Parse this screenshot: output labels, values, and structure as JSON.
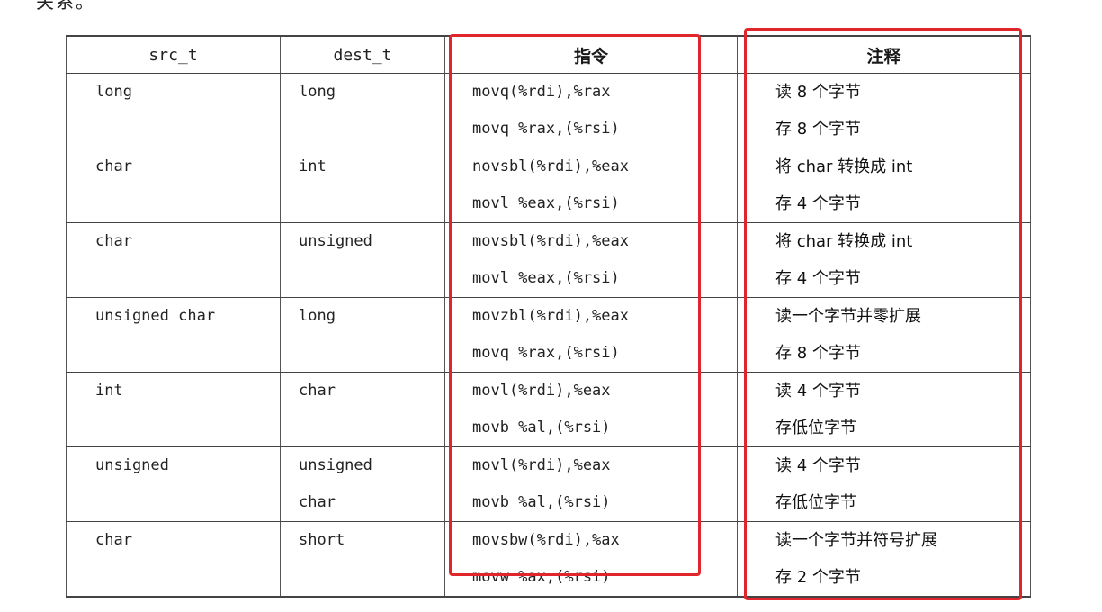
{
  "intro": "关系。",
  "table": {
    "headers": [
      "src_t",
      "dest_t",
      "指令",
      "注释"
    ],
    "rows": [
      {
        "src": [
          "long"
        ],
        "dest": [
          "long"
        ],
        "instr": [
          "movq(%rdi),%rax",
          "movq %rax,(%rsi)"
        ],
        "comment": [
          "读 8 个字节",
          "存 8 个字节"
        ]
      },
      {
        "src": [
          "char"
        ],
        "dest": [
          "int"
        ],
        "instr": [
          "novsbl(%rdi),%eax",
          "movl %eax,(%rsi)"
        ],
        "comment": [
          "将 char 转换成 int",
          "存 4 个字节"
        ]
      },
      {
        "src": [
          "char"
        ],
        "dest": [
          "unsigned"
        ],
        "instr": [
          "movsbl(%rdi),%eax",
          "movl %eax,(%rsi)"
        ],
        "comment": [
          "将 char 转换成 int",
          "存 4 个字节"
        ]
      },
      {
        "src": [
          "unsigned char"
        ],
        "dest": [
          "long"
        ],
        "instr": [
          "movzbl(%rdi),%eax",
          "movq %rax,(%rsi)"
        ],
        "comment": [
          "读一个字节并零扩展",
          "存 8 个字节"
        ]
      },
      {
        "src": [
          "int"
        ],
        "dest": [
          "char"
        ],
        "instr": [
          "movl(%rdi),%eax",
          "movb %al,(%rsi)"
        ],
        "comment": [
          "读 4 个字节",
          "存低位字节"
        ]
      },
      {
        "src": [
          "unsigned"
        ],
        "dest": [
          "unsigned",
          "char"
        ],
        "instr": [
          "movl(%rdi),%eax",
          "movb %al,(%rsi)"
        ],
        "comment": [
          "读 4 个字节",
          "存低位字节"
        ]
      },
      {
        "src": [
          "char"
        ],
        "dest": [
          "short"
        ],
        "instr": [
          "movsbw(%rdi),%ax",
          "movw %ax,(%rsi)"
        ],
        "comment": [
          "读一个字节并符号扩展",
          "存 2 个字节"
        ]
      }
    ]
  },
  "highlight_color": "#e0262a"
}
